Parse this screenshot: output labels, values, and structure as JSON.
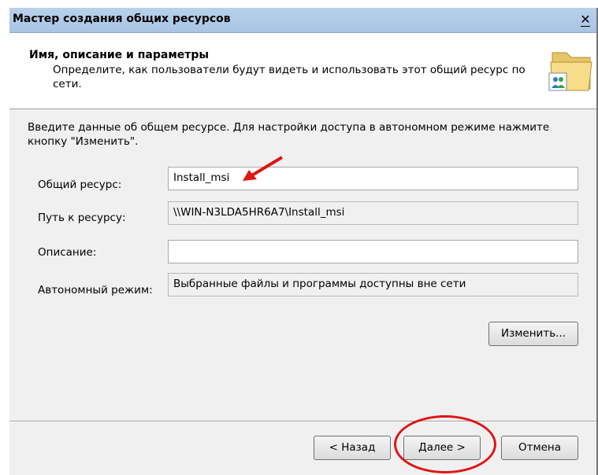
{
  "window": {
    "title": "Мастер создания общих ресурсов",
    "close_glyph": "✕"
  },
  "header": {
    "title": "Имя, описание и параметры",
    "description": "Определите, как пользователи будут видеть и использовать этот общий ресурс по сети.",
    "icon": "shared-folder-icon"
  },
  "form": {
    "intro": "Введите данные об общем ресурсе. Для настройки доступа в автономном режиме нажмите кнопку \"Изменить\".",
    "share_name_label": "Общий ресурс:",
    "share_name_value": "Install_msi",
    "path_label": "Путь к ресурсу:",
    "path_value": "\\\\WIN-N3LDA5HR6A7\\Install_msi",
    "description_label": "Описание:",
    "description_value": "",
    "offline_label": "Автономный режим:",
    "offline_value": "Выбранные файлы и программы доступны вне сети",
    "change_button": "Изменить..."
  },
  "footer": {
    "back_button": "< Назад",
    "next_button": "Далее >",
    "cancel_button": "Отмена"
  },
  "annotations": {
    "color": "#e01515"
  }
}
